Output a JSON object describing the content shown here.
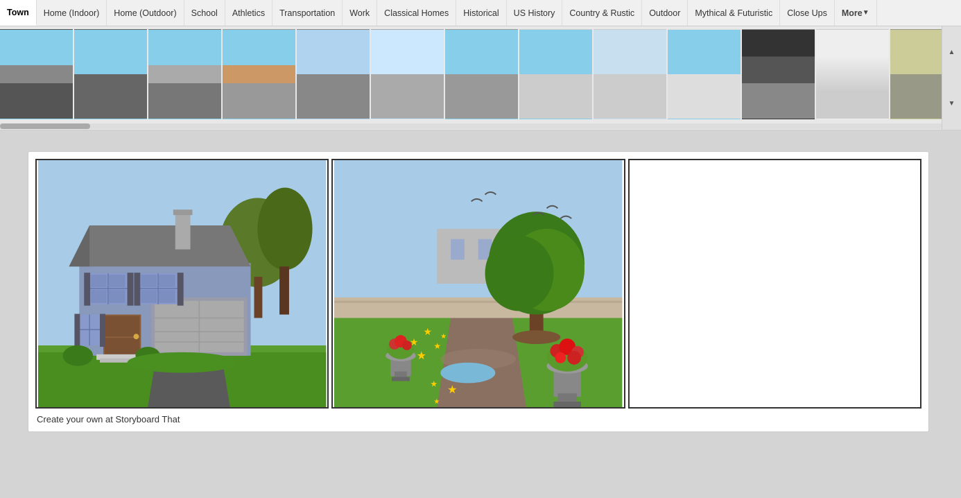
{
  "nav": {
    "tabs": [
      {
        "id": "town",
        "label": "Town",
        "active": true
      },
      {
        "id": "home-indoor",
        "label": "Home (Indoor)",
        "active": false
      },
      {
        "id": "home-outdoor",
        "label": "Home (Outdoor)",
        "active": false
      },
      {
        "id": "school",
        "label": "School",
        "active": false
      },
      {
        "id": "athletics",
        "label": "Athletics",
        "active": false
      },
      {
        "id": "transportation",
        "label": "Transportation",
        "active": false
      },
      {
        "id": "work",
        "label": "Work",
        "active": false
      },
      {
        "id": "classical-homes",
        "label": "Classical Homes",
        "active": false
      },
      {
        "id": "historical",
        "label": "Historical",
        "active": false
      },
      {
        "id": "us-history",
        "label": "US History",
        "active": false
      },
      {
        "id": "country-rustic",
        "label": "Country & Rustic",
        "active": false
      },
      {
        "id": "outdoor",
        "label": "Outdoor",
        "active": false
      },
      {
        "id": "mythical-futuristic",
        "label": "Mythical & Futuristic",
        "active": false
      },
      {
        "id": "close-ups",
        "label": "Close Ups",
        "active": false
      },
      {
        "id": "more",
        "label": "More",
        "active": false,
        "isMore": true
      }
    ]
  },
  "thumbStrip": {
    "items": [
      {
        "id": 1,
        "themeClass": "th1"
      },
      {
        "id": 2,
        "themeClass": "th2"
      },
      {
        "id": 3,
        "themeClass": "th3"
      },
      {
        "id": 4,
        "themeClass": "th4"
      },
      {
        "id": 5,
        "themeClass": "th5"
      },
      {
        "id": 6,
        "themeClass": "th6"
      },
      {
        "id": 7,
        "themeClass": "th7"
      },
      {
        "id": 8,
        "themeClass": "th8"
      },
      {
        "id": 9,
        "themeClass": "th9"
      },
      {
        "id": 10,
        "themeClass": "th10"
      },
      {
        "id": 11,
        "themeClass": "th11"
      },
      {
        "id": 12,
        "themeClass": "th12"
      },
      {
        "id": 13,
        "themeClass": "th13"
      }
    ]
  },
  "storyboard": {
    "cells": [
      {
        "id": 1,
        "hasContent": true,
        "type": "house-exterior"
      },
      {
        "id": 2,
        "hasContent": true,
        "type": "garden"
      },
      {
        "id": 3,
        "hasContent": false,
        "type": "empty"
      }
    ],
    "caption": "Create your own at Storyboard That"
  },
  "arrows": {
    "up": "▲",
    "down": "▼"
  }
}
